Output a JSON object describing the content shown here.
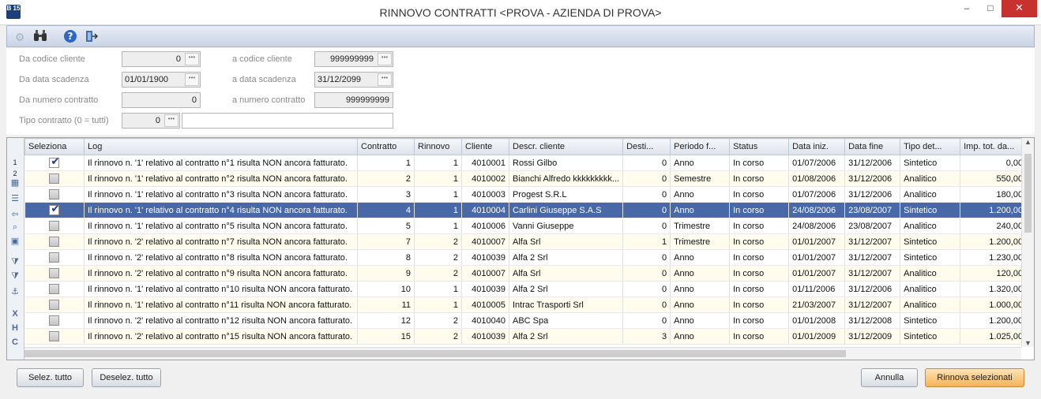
{
  "window": {
    "title": "RINNOVO CONTRATTI <PROVA - AZIENDA DI PROVA>",
    "logo": "B 15",
    "minimize": "–",
    "maximize": "□",
    "close": "✕"
  },
  "toolbar": {
    "icons": [
      "gear-icon",
      "binoculars-icon",
      "help-icon",
      "exit-door-icon"
    ]
  },
  "filters": {
    "from_client_label": "Da codice cliente",
    "from_client": "0",
    "to_client_label": "a codice cliente",
    "to_client": "999999999",
    "from_date_label": "Da data scadenza",
    "from_date": "01/01/1900",
    "to_date_label": "a data scadenza",
    "to_date": "31/12/2099",
    "from_contract_label": "Da numero contratto",
    "from_contract": "0",
    "to_contract_label": "a numero contratto",
    "to_contract": "999999999",
    "contract_type_label": "Tipo contratto (0 = tutti)",
    "contract_type": "0",
    "contract_type_desc": ""
  },
  "grid": {
    "columns": [
      "Seleziona",
      "Log",
      "Contratto",
      "Rinnovo",
      "Cliente",
      "Descr. cliente",
      "Desti...",
      "Periodo f...",
      "Status",
      "Data iniz.",
      "Data fine",
      "Tipo det...",
      "Imp. tot. da..."
    ],
    "rows": [
      {
        "sel": true,
        "log": "Il rinnovo n. '1' relativo al contratto n°1 risulta NON ancora fatturato.",
        "contratto": "1",
        "rinnovo": "1",
        "cliente": "4010001",
        "descr": "Rossi Gilbo",
        "desti": "0",
        "periodo": "Anno",
        "status": "In corso",
        "inizio": "01/07/2006",
        "fine": "31/12/2006",
        "tipo": "Sintetico",
        "imp": "0,00"
      },
      {
        "sel": false,
        "log": "Il rinnovo n. '1' relativo al contratto n°2 risulta NON ancora fatturato.",
        "contratto": "2",
        "rinnovo": "1",
        "cliente": "4010002",
        "descr": "Bianchi Alfredo kkkkkkkkk...",
        "desti": "0",
        "periodo": "Semestre",
        "status": "In corso",
        "inizio": "01/08/2006",
        "fine": "31/12/2006",
        "tipo": "Analitico",
        "imp": "550,00"
      },
      {
        "sel": false,
        "log": "Il rinnovo n. '1' relativo al contratto n°3 risulta NON ancora fatturato.",
        "contratto": "3",
        "rinnovo": "1",
        "cliente": "4010003",
        "descr": "Progest S.R.L",
        "desti": "0",
        "periodo": "Anno",
        "status": "In corso",
        "inizio": "01/07/2006",
        "fine": "31/12/2006",
        "tipo": "Analitico",
        "imp": "180,00"
      },
      {
        "sel": true,
        "log": "Il rinnovo n. '1' relativo al contratto n°4 risulta NON ancora fatturato.",
        "contratto": "4",
        "rinnovo": "1",
        "cliente": "4010004",
        "descr": "Carlini Giuseppe S.A.S",
        "desti": "0",
        "periodo": "Anno",
        "status": "In corso",
        "inizio": "24/08/2006",
        "fine": "23/08/2007",
        "tipo": "Sintetico",
        "imp": "1.200,00"
      },
      {
        "sel": false,
        "log": "Il rinnovo n. '1' relativo al contratto n°5 risulta NON ancora fatturato.",
        "contratto": "5",
        "rinnovo": "1",
        "cliente": "4010006",
        "descr": "Vanni Giuseppe",
        "desti": "0",
        "periodo": "Trimestre",
        "status": "In corso",
        "inizio": "24/08/2006",
        "fine": "23/08/2007",
        "tipo": "Analitico",
        "imp": "240,00"
      },
      {
        "sel": false,
        "log": "Il rinnovo n. '2' relativo al contratto n°7 risulta NON ancora fatturato.",
        "contratto": "7",
        "rinnovo": "2",
        "cliente": "4010007",
        "descr": "Alfa Srl",
        "desti": "1",
        "periodo": "Trimestre",
        "status": "In corso",
        "inizio": "01/01/2007",
        "fine": "31/12/2007",
        "tipo": "Sintetico",
        "imp": "1.200,00"
      },
      {
        "sel": false,
        "log": "Il rinnovo n. '2' relativo al contratto n°8 risulta NON ancora fatturato.",
        "contratto": "8",
        "rinnovo": "2",
        "cliente": "4010039",
        "descr": "Alfa 2 Srl",
        "desti": "0",
        "periodo": "Anno",
        "status": "In corso",
        "inizio": "01/01/2007",
        "fine": "31/12/2007",
        "tipo": "Sintetico",
        "imp": "1.230,00"
      },
      {
        "sel": false,
        "log": "Il rinnovo n. '2' relativo al contratto n°9 risulta NON ancora fatturato.",
        "contratto": "9",
        "rinnovo": "2",
        "cliente": "4010007",
        "descr": "Alfa Srl",
        "desti": "0",
        "periodo": "Anno",
        "status": "In corso",
        "inizio": "01/01/2007",
        "fine": "31/12/2007",
        "tipo": "Analitico",
        "imp": "120,00"
      },
      {
        "sel": false,
        "log": "Il rinnovo n. '1' relativo al contratto n°10 risulta NON ancora fatturato.",
        "contratto": "10",
        "rinnovo": "1",
        "cliente": "4010039",
        "descr": "Alfa 2 Srl",
        "desti": "0",
        "periodo": "Anno",
        "status": "In corso",
        "inizio": "01/11/2006",
        "fine": "31/12/2006",
        "tipo": "Analitico",
        "imp": "1.320,00"
      },
      {
        "sel": false,
        "log": "Il rinnovo n. '1' relativo al contratto n°11 risulta NON ancora fatturato.",
        "contratto": "11",
        "rinnovo": "1",
        "cliente": "4010005",
        "descr": "Intrac Trasporti Srl",
        "desti": "0",
        "periodo": "Anno",
        "status": "In corso",
        "inizio": "21/03/2007",
        "fine": "31/12/2007",
        "tipo": "Analitico",
        "imp": "1.000,00"
      },
      {
        "sel": false,
        "log": "Il rinnovo n. '2' relativo al contratto n°12 risulta NON ancora fatturato.",
        "contratto": "12",
        "rinnovo": "2",
        "cliente": "4010040",
        "descr": "ABC Spa",
        "desti": "0",
        "periodo": "Anno",
        "status": "In corso",
        "inizio": "01/01/2008",
        "fine": "31/12/2008",
        "tipo": "Sintetico",
        "imp": "1.200,00"
      },
      {
        "sel": false,
        "log": "Il rinnovo n. '2' relativo al contratto n°15 risulta NON ancora fatturato.",
        "contratto": "15",
        "rinnovo": "2",
        "cliente": "4010039",
        "descr": "Alfa 2 Srl",
        "desti": "3",
        "periodo": "Anno",
        "status": "In corso",
        "inizio": "01/01/2009",
        "fine": "31/12/2009",
        "tipo": "Sintetico",
        "imp": "1.025,00"
      }
    ],
    "selected_row_index": 3
  },
  "buttons": {
    "select_all": "Selez. tutto",
    "deselect_all": "Deselez. tutto",
    "cancel": "Annulla",
    "renew": "Rinnova selezionati"
  }
}
